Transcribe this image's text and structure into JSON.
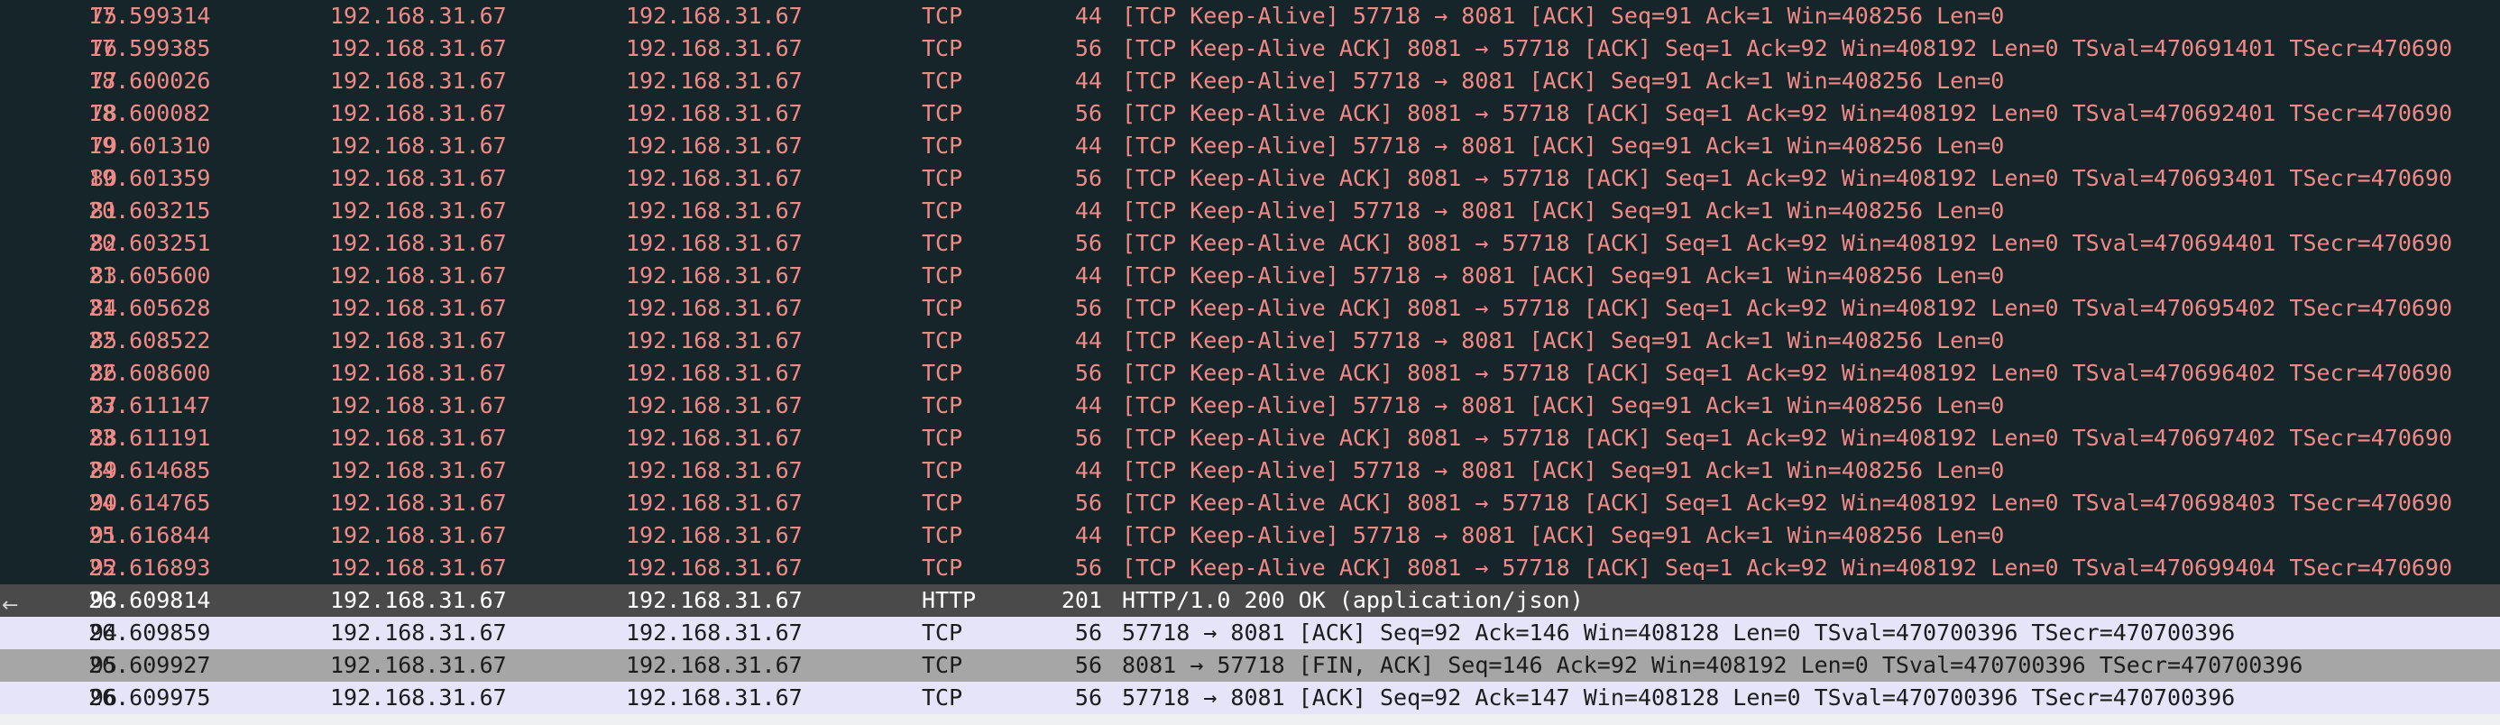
{
  "packet_list": {
    "rows": [
      {
        "no": "75",
        "time": "17.599314",
        "source": "192.168.31.67",
        "destination": "192.168.31.67",
        "protocol": "TCP",
        "length": "44",
        "info": "[TCP Keep-Alive] 57718 → 8081 [ACK] Seq=91 Ack=1 Win=408256 Len=0",
        "style": "tcp-bad"
      },
      {
        "no": "76",
        "time": "17.599385",
        "source": "192.168.31.67",
        "destination": "192.168.31.67",
        "protocol": "TCP",
        "length": "56",
        "info": "[TCP Keep-Alive ACK] 8081 → 57718 [ACK] Seq=1 Ack=92 Win=408192 Len=0 TSval=470691401 TSecr=470690",
        "style": "tcp-bad"
      },
      {
        "no": "77",
        "time": "18.600026",
        "source": "192.168.31.67",
        "destination": "192.168.31.67",
        "protocol": "TCP",
        "length": "44",
        "info": "[TCP Keep-Alive] 57718 → 8081 [ACK] Seq=91 Ack=1 Win=408256 Len=0",
        "style": "tcp-bad"
      },
      {
        "no": "78",
        "time": "18.600082",
        "source": "192.168.31.67",
        "destination": "192.168.31.67",
        "protocol": "TCP",
        "length": "56",
        "info": "[TCP Keep-Alive ACK] 8081 → 57718 [ACK] Seq=1 Ack=92 Win=408192 Len=0 TSval=470692401 TSecr=470690",
        "style": "tcp-bad"
      },
      {
        "no": "79",
        "time": "19.601310",
        "source": "192.168.31.67",
        "destination": "192.168.31.67",
        "protocol": "TCP",
        "length": "44",
        "info": "[TCP Keep-Alive] 57718 → 8081 [ACK] Seq=91 Ack=1 Win=408256 Len=0",
        "style": "tcp-bad"
      },
      {
        "no": "80",
        "time": "19.601359",
        "source": "192.168.31.67",
        "destination": "192.168.31.67",
        "protocol": "TCP",
        "length": "56",
        "info": "[TCP Keep-Alive ACK] 8081 → 57718 [ACK] Seq=1 Ack=92 Win=408192 Len=0 TSval=470693401 TSecr=470690",
        "style": "tcp-bad"
      },
      {
        "no": "81",
        "time": "20.603215",
        "source": "192.168.31.67",
        "destination": "192.168.31.67",
        "protocol": "TCP",
        "length": "44",
        "info": "[TCP Keep-Alive] 57718 → 8081 [ACK] Seq=91 Ack=1 Win=408256 Len=0",
        "style": "tcp-bad"
      },
      {
        "no": "82",
        "time": "20.603251",
        "source": "192.168.31.67",
        "destination": "192.168.31.67",
        "protocol": "TCP",
        "length": "56",
        "info": "[TCP Keep-Alive ACK] 8081 → 57718 [ACK] Seq=1 Ack=92 Win=408192 Len=0 TSval=470694401 TSecr=470690",
        "style": "tcp-bad"
      },
      {
        "no": "83",
        "time": "21.605600",
        "source": "192.168.31.67",
        "destination": "192.168.31.67",
        "protocol": "TCP",
        "length": "44",
        "info": "[TCP Keep-Alive] 57718 → 8081 [ACK] Seq=91 Ack=1 Win=408256 Len=0",
        "style": "tcp-bad"
      },
      {
        "no": "84",
        "time": "21.605628",
        "source": "192.168.31.67",
        "destination": "192.168.31.67",
        "protocol": "TCP",
        "length": "56",
        "info": "[TCP Keep-Alive ACK] 8081 → 57718 [ACK] Seq=1 Ack=92 Win=408192 Len=0 TSval=470695402 TSecr=470690",
        "style": "tcp-bad"
      },
      {
        "no": "85",
        "time": "22.608522",
        "source": "192.168.31.67",
        "destination": "192.168.31.67",
        "protocol": "TCP",
        "length": "44",
        "info": "[TCP Keep-Alive] 57718 → 8081 [ACK] Seq=91 Ack=1 Win=408256 Len=0",
        "style": "tcp-bad"
      },
      {
        "no": "86",
        "time": "22.608600",
        "source": "192.168.31.67",
        "destination": "192.168.31.67",
        "protocol": "TCP",
        "length": "56",
        "info": "[TCP Keep-Alive ACK] 8081 → 57718 [ACK] Seq=1 Ack=92 Win=408192 Len=0 TSval=470696402 TSecr=470690",
        "style": "tcp-bad"
      },
      {
        "no": "87",
        "time": "23.611147",
        "source": "192.168.31.67",
        "destination": "192.168.31.67",
        "protocol": "TCP",
        "length": "44",
        "info": "[TCP Keep-Alive] 57718 → 8081 [ACK] Seq=91 Ack=1 Win=408256 Len=0",
        "style": "tcp-bad"
      },
      {
        "no": "88",
        "time": "23.611191",
        "source": "192.168.31.67",
        "destination": "192.168.31.67",
        "protocol": "TCP",
        "length": "56",
        "info": "[TCP Keep-Alive ACK] 8081 → 57718 [ACK] Seq=1 Ack=92 Win=408192 Len=0 TSval=470697402 TSecr=470690",
        "style": "tcp-bad"
      },
      {
        "no": "89",
        "time": "24.614685",
        "source": "192.168.31.67",
        "destination": "192.168.31.67",
        "protocol": "TCP",
        "length": "44",
        "info": "[TCP Keep-Alive] 57718 → 8081 [ACK] Seq=91 Ack=1 Win=408256 Len=0",
        "style": "tcp-bad"
      },
      {
        "no": "90",
        "time": "24.614765",
        "source": "192.168.31.67",
        "destination": "192.168.31.67",
        "protocol": "TCP",
        "length": "56",
        "info": "[TCP Keep-Alive ACK] 8081 → 57718 [ACK] Seq=1 Ack=92 Win=408192 Len=0 TSval=470698403 TSecr=470690",
        "style": "tcp-bad"
      },
      {
        "no": "91",
        "time": "25.616844",
        "source": "192.168.31.67",
        "destination": "192.168.31.67",
        "protocol": "TCP",
        "length": "44",
        "info": "[TCP Keep-Alive] 57718 → 8081 [ACK] Seq=91 Ack=1 Win=408256 Len=0",
        "style": "tcp-bad"
      },
      {
        "no": "92",
        "time": "25.616893",
        "source": "192.168.31.67",
        "destination": "192.168.31.67",
        "protocol": "TCP",
        "length": "56",
        "info": "[TCP Keep-Alive ACK] 8081 → 57718 [ACK] Seq=1 Ack=92 Win=408192 Len=0 TSval=470699404 TSecr=470690",
        "style": "tcp-bad"
      },
      {
        "no": "93",
        "time": "26.609814",
        "source": "192.168.31.67",
        "destination": "192.168.31.67",
        "protocol": "HTTP",
        "length": "201",
        "info": "HTTP/1.0 200 OK  (application/json)",
        "style": "selected"
      },
      {
        "no": "94",
        "time": "26.609859",
        "source": "192.168.31.67",
        "destination": "192.168.31.67",
        "protocol": "TCP",
        "length": "56",
        "info": "57718 → 8081 [ACK] Seq=92 Ack=146 Win=408128 Len=0 TSval=470700396 TSecr=470700396",
        "style": "light"
      },
      {
        "no": "95",
        "time": "26.609927",
        "source": "192.168.31.67",
        "destination": "192.168.31.67",
        "protocol": "TCP",
        "length": "56",
        "info": "8081 → 57718 [FIN, ACK] Seq=146 Ack=92 Win=408192 Len=0 TSval=470700396 TSecr=470700396",
        "style": "fin"
      },
      {
        "no": "96",
        "time": "26.609975",
        "source": "192.168.31.67",
        "destination": "192.168.31.67",
        "protocol": "TCP",
        "length": "56",
        "info": "57718 → 8081 [ACK] Seq=92 Ack=147 Win=408128 Len=0 TSval=470700396 TSecr=470700396",
        "style": "light"
      }
    ]
  },
  "colors": {
    "background": "#16252a",
    "bad_tcp_text": "#f08a86",
    "selected_row": "#4a4a4a",
    "light_row": "#e5e4f8",
    "fin_row": "#a6a6a6"
  },
  "icons": {
    "conversation_arrow": "←"
  }
}
